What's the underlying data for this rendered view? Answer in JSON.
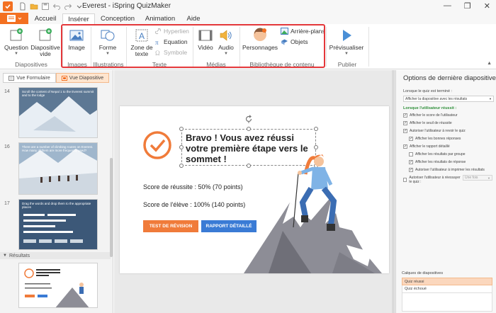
{
  "titlebar": {
    "title": "Everest  -  iSpring QuizMaker"
  },
  "tabs": [
    {
      "label": "Accueil"
    },
    {
      "label": "Insérer"
    },
    {
      "label": "Conception"
    },
    {
      "label": "Animation"
    },
    {
      "label": "Aide"
    }
  ],
  "ribbon": {
    "question": "Question",
    "diapositive_vide": "Diapositive vide",
    "image": "Image",
    "forme": "Forme",
    "zone_de_texte": "Zone de texte",
    "hyperlien": "Hyperlien",
    "equation": "Equation",
    "symbole": "Symbole",
    "video": "Vidéo",
    "audio": "Audio",
    "personnages": "Personnages",
    "arriere_plans": "Arrière-plans",
    "objets": "Objets",
    "previsualiser": "Prévisualiser",
    "groups": {
      "diapositives": "Diapositives",
      "images": "Images",
      "illustrations": "Illustrations",
      "texte": "Texte",
      "medias": "Médias",
      "bibliotheque": "Bibliothèque de contenu",
      "publier": "Publier"
    }
  },
  "left": {
    "vue_formulaire": "Vue Formulaire",
    "vue_diapositive": "Vue Diapositive",
    "slide14": "14",
    "slide16": "16",
    "slide17": "17",
    "resultats": "Résultats",
    "thumb14_text": "Scroll the content of Nepal 1 to the Everest summit and to the lodge",
    "thumb16_text": "There are a number of climbing routes on Everest. How many of them are more frequently used?",
    "thumb17_text": "Drag the words and drop them to the appropriate places"
  },
  "slide": {
    "title": "Bravo ! Vous avez réussi votre première étape vers le sommet !",
    "score_reussite": "Score de réussite : 50% (70 points)",
    "score_eleve": "Score de l'élève : 100% (140 points)",
    "btn_revision": "TEST DE RÉVISION",
    "btn_rapport": "RAPPORT DÉTAILLÉ",
    "accent": "#f07b3a",
    "blue": "#3a7bd5"
  },
  "right": {
    "title": "Options de dernière diapositive",
    "quiz_termine": "Lorsque le quiz est terminé :",
    "select_value": "Afficher la diapositive avec les résultats",
    "reussit": "Lorsque l'utilisateur réussit :",
    "opt1": "Afficher le score de l'utilisateur",
    "opt2": "Afficher le seuil de réussite",
    "opt3": "Autoriser l'utilisateur à revoir le quiz",
    "opt4": "Afficher les bonnes réponses",
    "opt5": "Afficher le rapport détaillé",
    "opt6": "Afficher les résultats par groupe",
    "opt7": "Afficher les résultats de réponse",
    "opt8": "Autoriser l'utilisateur à imprimer les résultats",
    "opt9": "Autoriser l'utilisateur à réessayer le quiz :",
    "retry_value": "Une fois",
    "calques": "Calques de diapositives",
    "layer1": "Quiz réussi",
    "layer2": "Quiz échoué"
  }
}
